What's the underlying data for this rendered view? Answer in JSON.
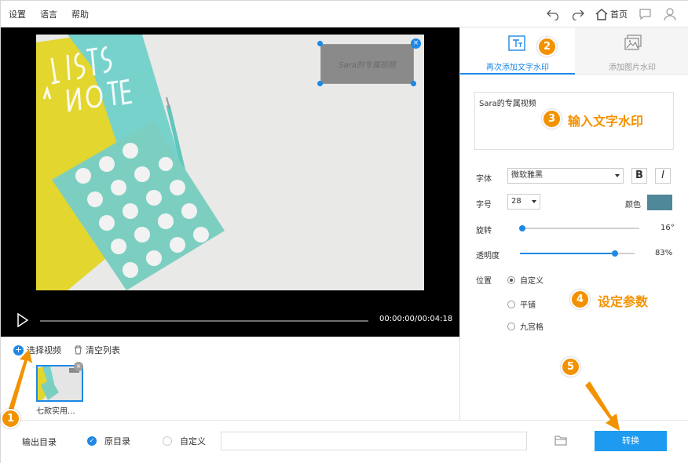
{
  "menu": {
    "settings": "设置",
    "language": "语言",
    "help": "帮助"
  },
  "toolbar": {
    "home_label": "首页",
    "icons": [
      "undo-icon",
      "redo-icon",
      "home-icon",
      "chat-icon",
      "user-icon"
    ]
  },
  "player": {
    "time": "00:00:00/00:04:18",
    "watermark_preview": "Sara的专属视频"
  },
  "filelist": {
    "add_label": "选择视频",
    "clear_label": "清空列表",
    "items": [
      {
        "name": "七款实用..."
      }
    ]
  },
  "panel": {
    "tabs": [
      {
        "label": "再次添加文字水印"
      },
      {
        "label": "添加图片水印"
      }
    ],
    "watermark_text": "Sara的专属视频",
    "font": {
      "label": "字体",
      "value": "微软雅黑"
    },
    "bold_label": "B",
    "italic_label": "I",
    "size": {
      "label": "字号",
      "value": "28"
    },
    "color": {
      "label": "颜色",
      "value": "#4f8898"
    },
    "rotation": {
      "label": "旋转",
      "value": "16°",
      "fraction": 0.02
    },
    "opacity": {
      "label": "透明度",
      "value": "83%",
      "fraction": 0.83
    },
    "position": {
      "label": "位置",
      "options": [
        {
          "label": "自定义",
          "selected": true
        },
        {
          "label": "平铺",
          "selected": false
        },
        {
          "label": "九宫格",
          "selected": false
        }
      ]
    }
  },
  "bottom": {
    "output_label": "输出目录",
    "options": [
      {
        "label": "原目录",
        "selected": true
      },
      {
        "label": "自定义",
        "selected": false
      }
    ],
    "path": "",
    "convert_label": "转换"
  },
  "annotations": {
    "badges": [
      "1",
      "2",
      "3",
      "4",
      "5"
    ],
    "step3": "输入文字水印",
    "step4": "设定参数"
  },
  "colors": {
    "accent": "#1e88e5",
    "annotation": "#f39200"
  }
}
